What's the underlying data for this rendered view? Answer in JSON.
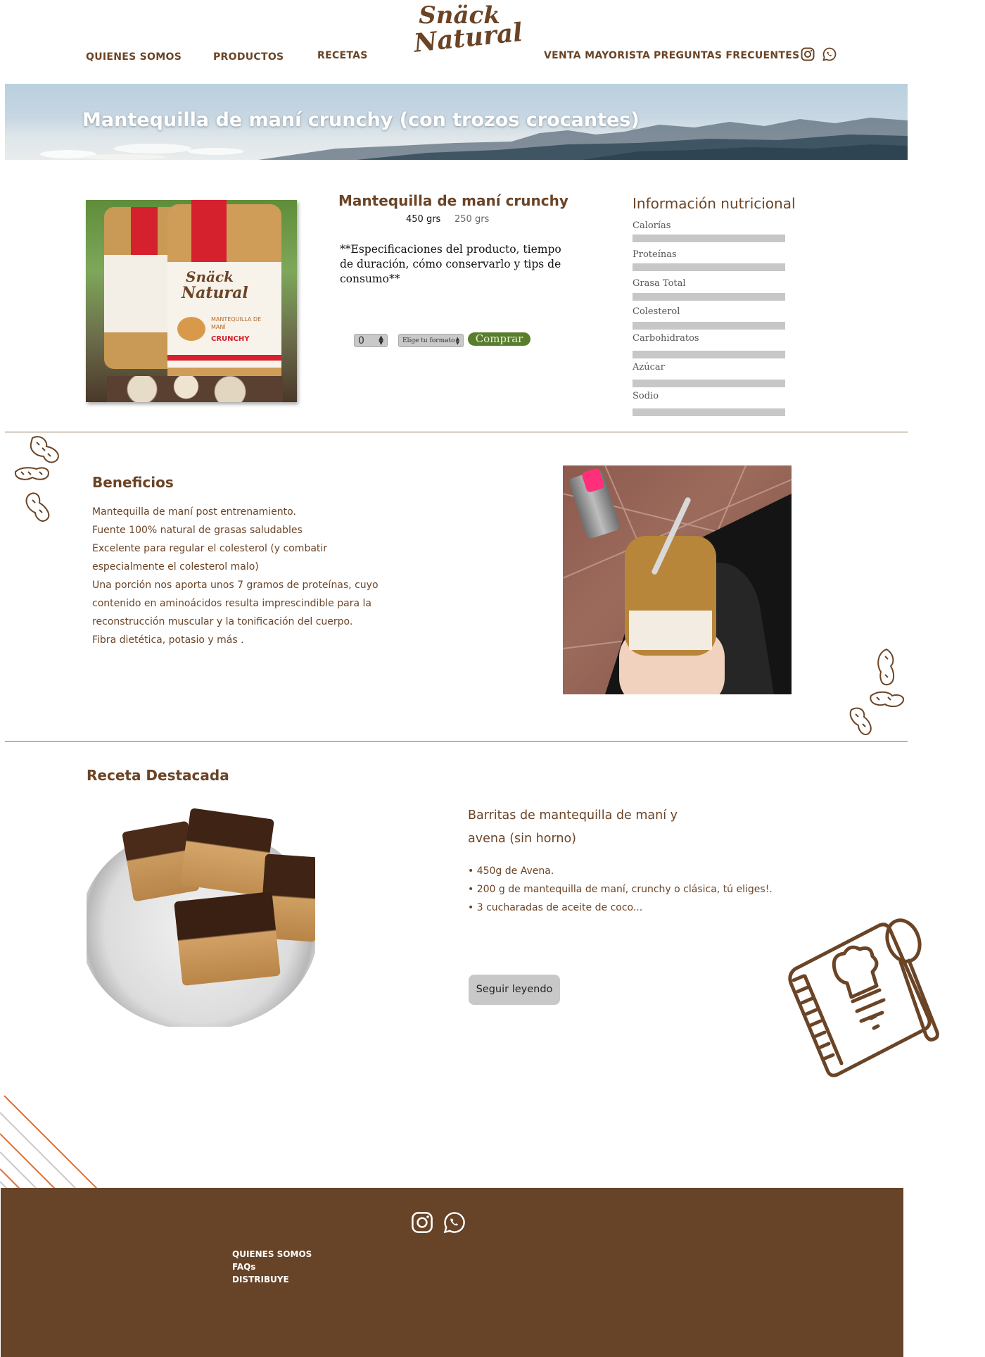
{
  "header": {
    "logo_line1": "Snäck",
    "logo_line2": "Natural",
    "nav_left": [
      "QUIENES SOMOS",
      "PRODUCTOS",
      "RECETAS"
    ],
    "nav_right": [
      "VENTA MAYORISTA",
      "PREGUNTAS FRECUENTES"
    ],
    "social_icons": [
      "instagram-icon",
      "whatsapp-icon"
    ]
  },
  "banner": {
    "title": "Mantequilla de maní crunchy (con trozos crocantes)"
  },
  "product": {
    "title": "Mantequilla de maní crunchy",
    "formats": [
      "450 grs",
      "250 grs"
    ],
    "selected_format": "450 grs",
    "description": "**Especificaciones del producto, tiempo de duración, cómo conservarlo y tips de consumo**",
    "quantity_value": "0",
    "format_select_placeholder": "Elige tu formato",
    "buy_label": "Comprar",
    "buy_color": "#577d2d",
    "jar_label_line1": "Snäck",
    "jar_label_line2": "Natural",
    "jar_label_line3": "MANTEQUILLA DE MANÍ",
    "jar_label_line4": "CRUNCHY"
  },
  "nutrition": {
    "title": "Información nutricional",
    "items": [
      "Calorías",
      "Proteínas",
      "Grasa Total",
      "Colesterol",
      "Carbohidratos",
      "Azúcar",
      "Sodio"
    ]
  },
  "benefits": {
    "title": "Beneficios",
    "lines": [
      "Mantequilla de maní post entrenamiento.",
      "Fuente 100% natural de grasas saludables",
      "Excelente para regular el colesterol (y combatir",
      "especialmente el colesterol malo)",
      "Una porción nos aporta unos 7 gramos de proteínas, cuyo",
      "contenido en aminoácidos resulta imprescindible para la",
      "reconstrucción muscular y la tonificación del cuerpo.",
      "Fibra dietética, potasio y más ."
    ]
  },
  "recipe": {
    "section_title": "Receta Destacada",
    "title_line1": "Barritas de mantequilla de maní y",
    "title_line2": "avena (sin horno)",
    "ingredients": [
      "• 450g de Avena.",
      "• 200 g de mantequilla de maní, crunchy o clásica, tú eliges!.",
      "• 3 cucharadas de aceite de coco..."
    ],
    "read_more_label": "Seguir leyendo"
  },
  "footer": {
    "social_icons": [
      "instagram-icon",
      "whatsapp-icon"
    ],
    "links": [
      "QUIENES SOMOS",
      "FAQs",
      "DISTRIBUYE"
    ]
  },
  "colors": {
    "brand_brown": "#6b4426",
    "footer_brown": "#674327",
    "buy_green": "#577d2d",
    "bar_gray": "#c7c7c7",
    "accent_orange": "#e0703a"
  }
}
